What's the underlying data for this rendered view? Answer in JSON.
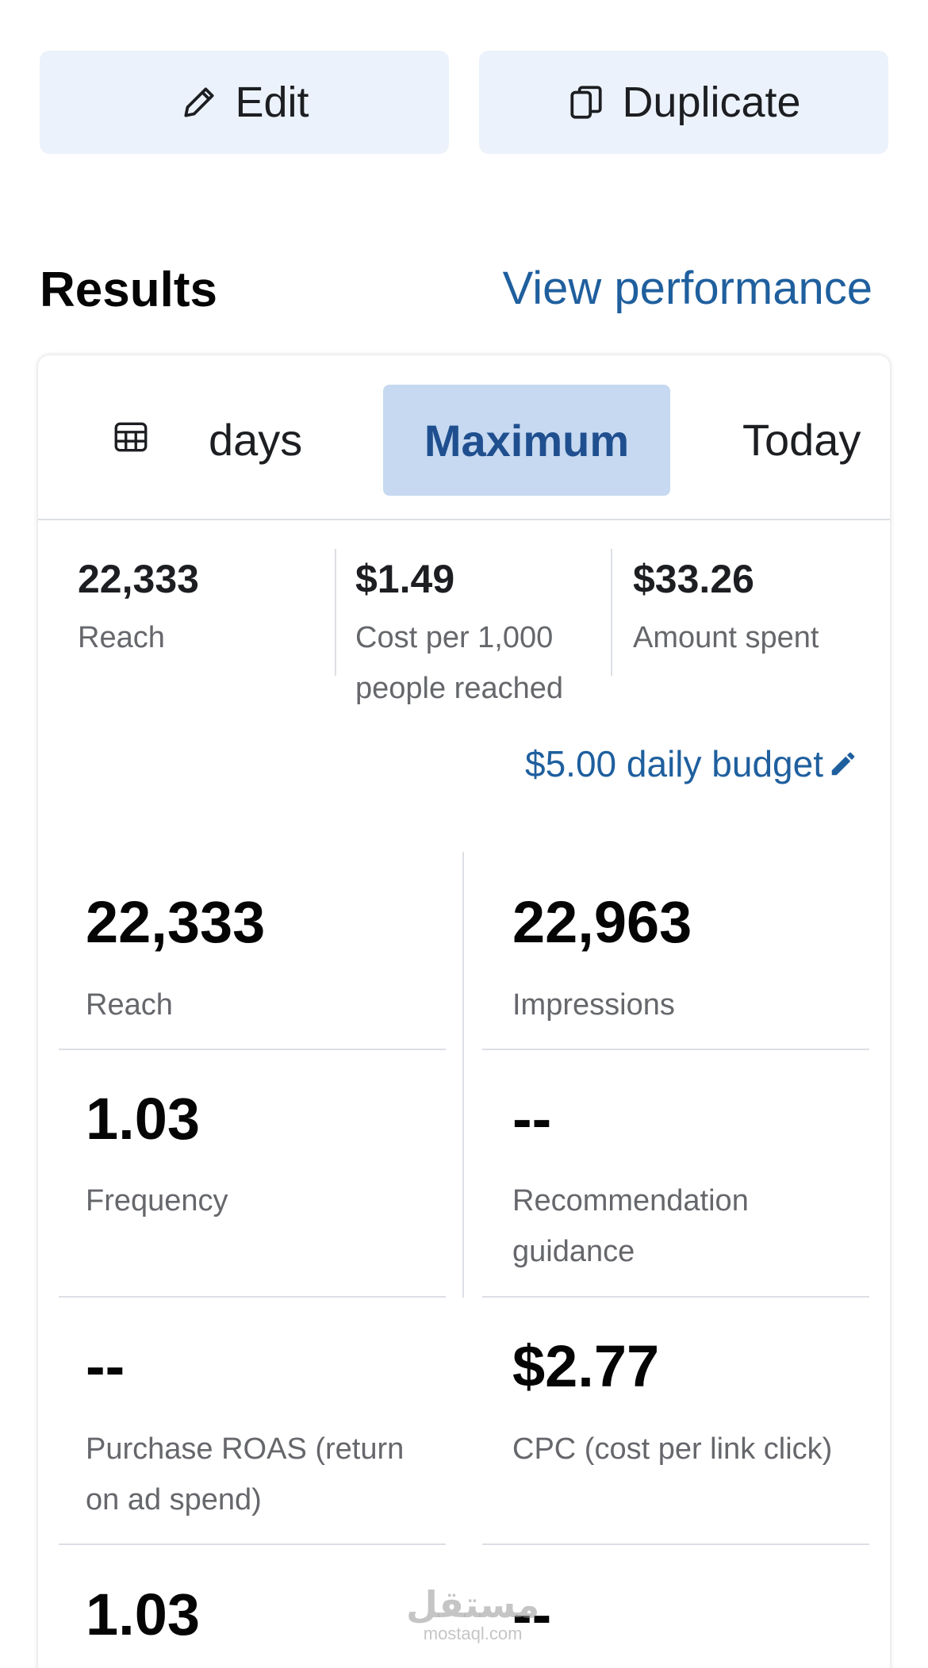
{
  "actions": {
    "edit_label": "Edit",
    "duplicate_label": "Duplicate"
  },
  "results": {
    "title": "Results",
    "view_performance": "View performance"
  },
  "tabs": {
    "days": "days",
    "maximum": "Maximum",
    "today": "Today"
  },
  "summary": [
    {
      "value": "22,333",
      "label": "Reach"
    },
    {
      "value": "$1.49",
      "label": "Cost per 1,000 people reached"
    },
    {
      "value": "$33.26",
      "label": "Amount spent"
    }
  ],
  "budget": "$5.00 daily budget",
  "metrics": [
    {
      "value": "22,333",
      "label": "Reach"
    },
    {
      "value": "22,963",
      "label": "Impressions"
    },
    {
      "value": "1.03",
      "label": "Frequency"
    },
    {
      "value": "--",
      "label": "Recommendation guidance"
    },
    {
      "value": "--",
      "label": "Purchase ROAS (return on ad spend)"
    },
    {
      "value": "$2.77",
      "label": "CPC (cost per link click)"
    },
    {
      "value": "1.03",
      "label": ""
    },
    {
      "value": "--",
      "label": ""
    }
  ],
  "watermark": {
    "arabic": "مستقل",
    "latin": "mostaql.com"
  },
  "colors": {
    "accent": "#1f5f9e",
    "button_bg": "#ebf2fb",
    "active_tab_bg": "#c6d9f0",
    "muted_text": "#65676b"
  },
  "icons": [
    "pencil-icon",
    "duplicate-icon",
    "calendar-icon",
    "edit-pencil-icon"
  ]
}
